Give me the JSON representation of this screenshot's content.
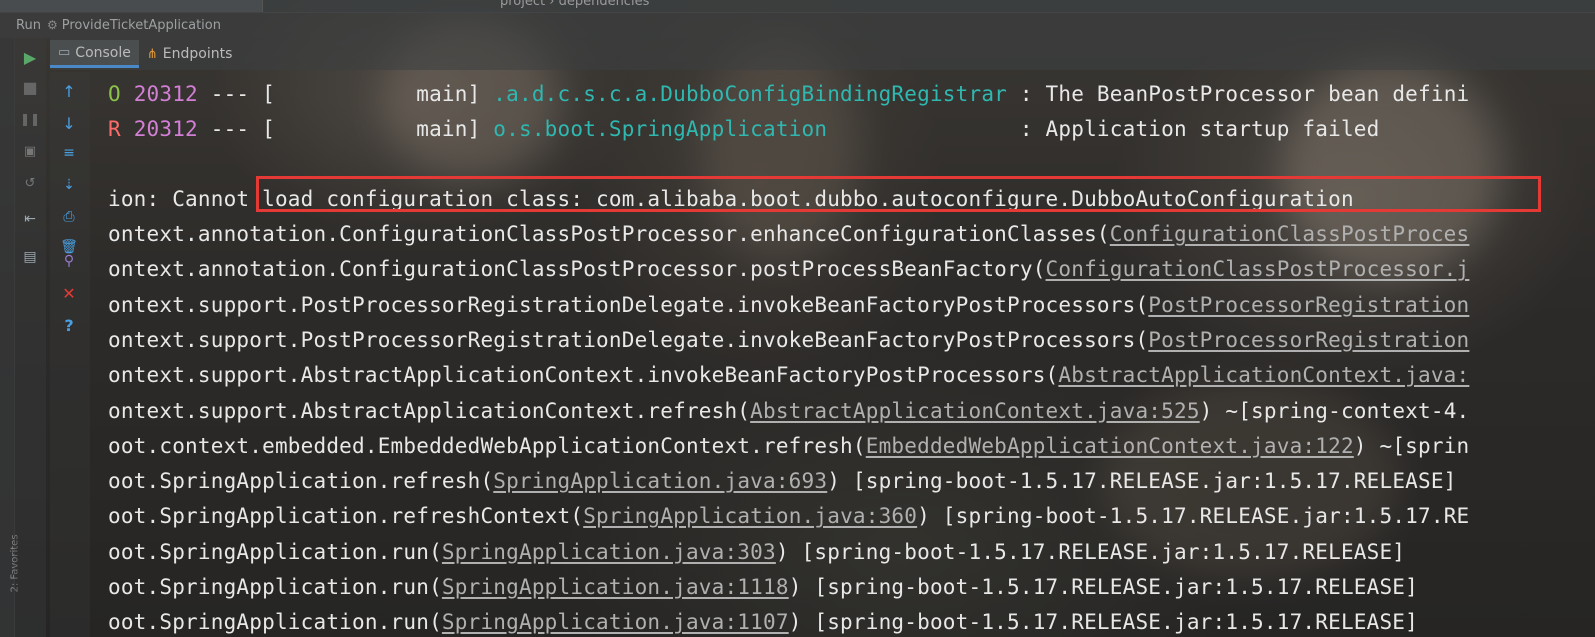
{
  "top": {
    "breadcrumb": "project  ›  dependencies"
  },
  "run_bar": {
    "label": "Run",
    "app_icon": "spring-app-icon",
    "config_name": "ProvideTicketApplication"
  },
  "tabs": [
    {
      "label": "Console",
      "icon": "console-icon",
      "active": true
    },
    {
      "label": "Endpoints",
      "icon": "endpoints-icon",
      "active": false
    }
  ],
  "toolbar_icons": {
    "col1": [
      "rerun-icon",
      "stop-icon",
      "pause-icon",
      "dump-threads-icon",
      "restore-layout-icon",
      "exit-icon",
      "pin-tab-icon"
    ],
    "col2": [
      "scroll-up-icon",
      "scroll-down-icon",
      "soft-wrap-icon",
      "scroll-to-end-icon",
      "print-icon",
      "clear-all-icon",
      "pin-icon",
      "close-icon",
      "help-icon"
    ]
  },
  "edge": {
    "favorites_label": "2: Favorites"
  },
  "colors": {
    "highlight_border": "#e53935",
    "logger": "#2fb8b0",
    "info_level": "#8bc34a",
    "error_level": "#ff6b68"
  },
  "log": {
    "line1": {
      "level": "O",
      "pid": "20312",
      "sep": " --- [           main] ",
      "logger": ".a.d.c.s.c.a.DubboConfigBindingRegistrar",
      "message": " : The BeanPostProcessor bean defini"
    },
    "line2": {
      "level": "R",
      "pid": "20312",
      "sep": " --- [           main] ",
      "logger": "o.s.boot.SpringApplication",
      "pad": "              ",
      "message": " : Application startup failed"
    },
    "exception_prefix": "ion: ",
    "exception_message": "Cannot load configuration class: com.alibaba.boot.dubbo.autoconfigure.DubboAutoConfiguration",
    "stack": [
      {
        "pre": "ontext.annotation.ConfigurationClassPostProcessor.enhanceConfigurationClasses(",
        "link": "ConfigurationClassPostProces",
        "post": ""
      },
      {
        "pre": "ontext.annotation.ConfigurationClassPostProcessor.postProcessBeanFactory(",
        "link": "ConfigurationClassPostProcessor.j",
        "post": ""
      },
      {
        "pre": "ontext.support.PostProcessorRegistrationDelegate.invokeBeanFactoryPostProcessors(",
        "link": "PostProcessorRegistration",
        "post": ""
      },
      {
        "pre": "ontext.support.PostProcessorRegistrationDelegate.invokeBeanFactoryPostProcessors(",
        "link": "PostProcessorRegistration",
        "post": ""
      },
      {
        "pre": "ontext.support.AbstractApplicationContext.invokeBeanFactoryPostProcessors(",
        "link": "AbstractApplicationContext.java:",
        "post": ""
      },
      {
        "pre": "ontext.support.AbstractApplicationContext.refresh(",
        "link": "AbstractApplicationContext.java:525",
        "post": ") ~[spring-context-4."
      },
      {
        "pre": "oot.context.embedded.EmbeddedWebApplicationContext.refresh(",
        "link": "EmbeddedWebApplicationContext.java:122",
        "post": ") ~[sprin"
      },
      {
        "pre": "oot.SpringApplication.refresh(",
        "link": "SpringApplication.java:693",
        "post": ") [spring-boot-1.5.17.RELEASE.jar:1.5.17.RELEASE]"
      },
      {
        "pre": "oot.SpringApplication.refreshContext(",
        "link": "SpringApplication.java:360",
        "post": ") [spring-boot-1.5.17.RELEASE.jar:1.5.17.RE"
      },
      {
        "pre": "oot.SpringApplication.run(",
        "link": "SpringApplication.java:303",
        "post": ") [spring-boot-1.5.17.RELEASE.jar:1.5.17.RELEASE]"
      },
      {
        "pre": "oot.SpringApplication.run(",
        "link": "SpringApplication.java:1118",
        "post": ") [spring-boot-1.5.17.RELEASE.jar:1.5.17.RELEASE]"
      },
      {
        "pre": "oot.SpringApplication.run(",
        "link": "SpringApplication.java:1107",
        "post": ") [spring-boot-1.5.17.RELEASE.jar:1.5.17.RELEASE]"
      }
    ]
  }
}
